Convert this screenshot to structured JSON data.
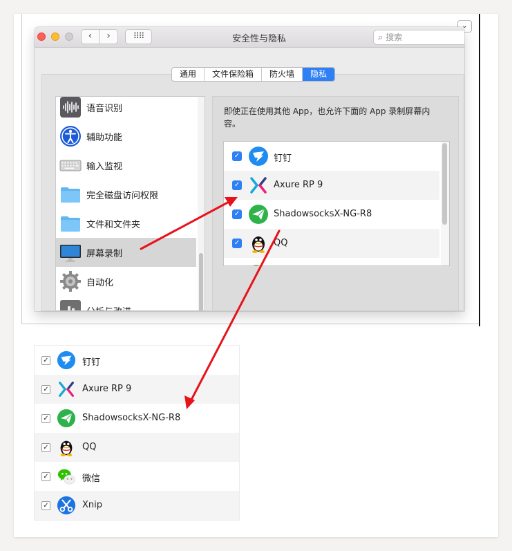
{
  "window": {
    "title": "安全性与隐私",
    "nav_back": "‹",
    "nav_forward": "›",
    "grid_glyph": "⠿⠿",
    "search_icon": "⌕",
    "search_placeholder": "搜索",
    "dropdown_glyph": "⌄"
  },
  "tabs": [
    {
      "label": "通用",
      "active": false
    },
    {
      "label": "文件保险箱",
      "active": false
    },
    {
      "label": "防火墙",
      "active": false
    },
    {
      "label": "隐私",
      "active": true
    }
  ],
  "sidebar": {
    "items": [
      {
        "label": "语音识别",
        "icon": "speech-recognition-icon"
      },
      {
        "label": "辅助功能",
        "icon": "accessibility-icon"
      },
      {
        "label": "输入监视",
        "icon": "keyboard-icon"
      },
      {
        "label": "完全磁盘访问权限",
        "icon": "folder-icon"
      },
      {
        "label": "文件和文件夹",
        "icon": "folder-icon"
      },
      {
        "label": "屏幕录制",
        "icon": "display-icon",
        "selected": true
      },
      {
        "label": "自动化",
        "icon": "gear-icon"
      },
      {
        "label": "分析与改进",
        "icon": "analytics-icon"
      }
    ]
  },
  "panel": {
    "description": "即使正在使用其他 App，也允许下面的 App 录制屏幕内容。"
  },
  "apps": [
    {
      "name": "钉钉",
      "checked": true,
      "icon": "dingtalk-icon"
    },
    {
      "name": "Axure RP 9",
      "checked": true,
      "icon": "axure-icon"
    },
    {
      "name": "ShadowsocksX-NG-R8",
      "checked": true,
      "icon": "shadowsocks-icon"
    },
    {
      "name": "QQ",
      "checked": true,
      "icon": "qq-icon"
    },
    {
      "name": "微信",
      "checked": true,
      "icon": "wechat-icon"
    },
    {
      "name": "Xnip",
      "checked": true,
      "icon": "xnip-icon"
    }
  ],
  "checkmark": "✓",
  "colors": {
    "accent": "#2f80f5",
    "arrow": "#e8121b",
    "close": "#fe5f57",
    "minimize": "#febc2e"
  }
}
